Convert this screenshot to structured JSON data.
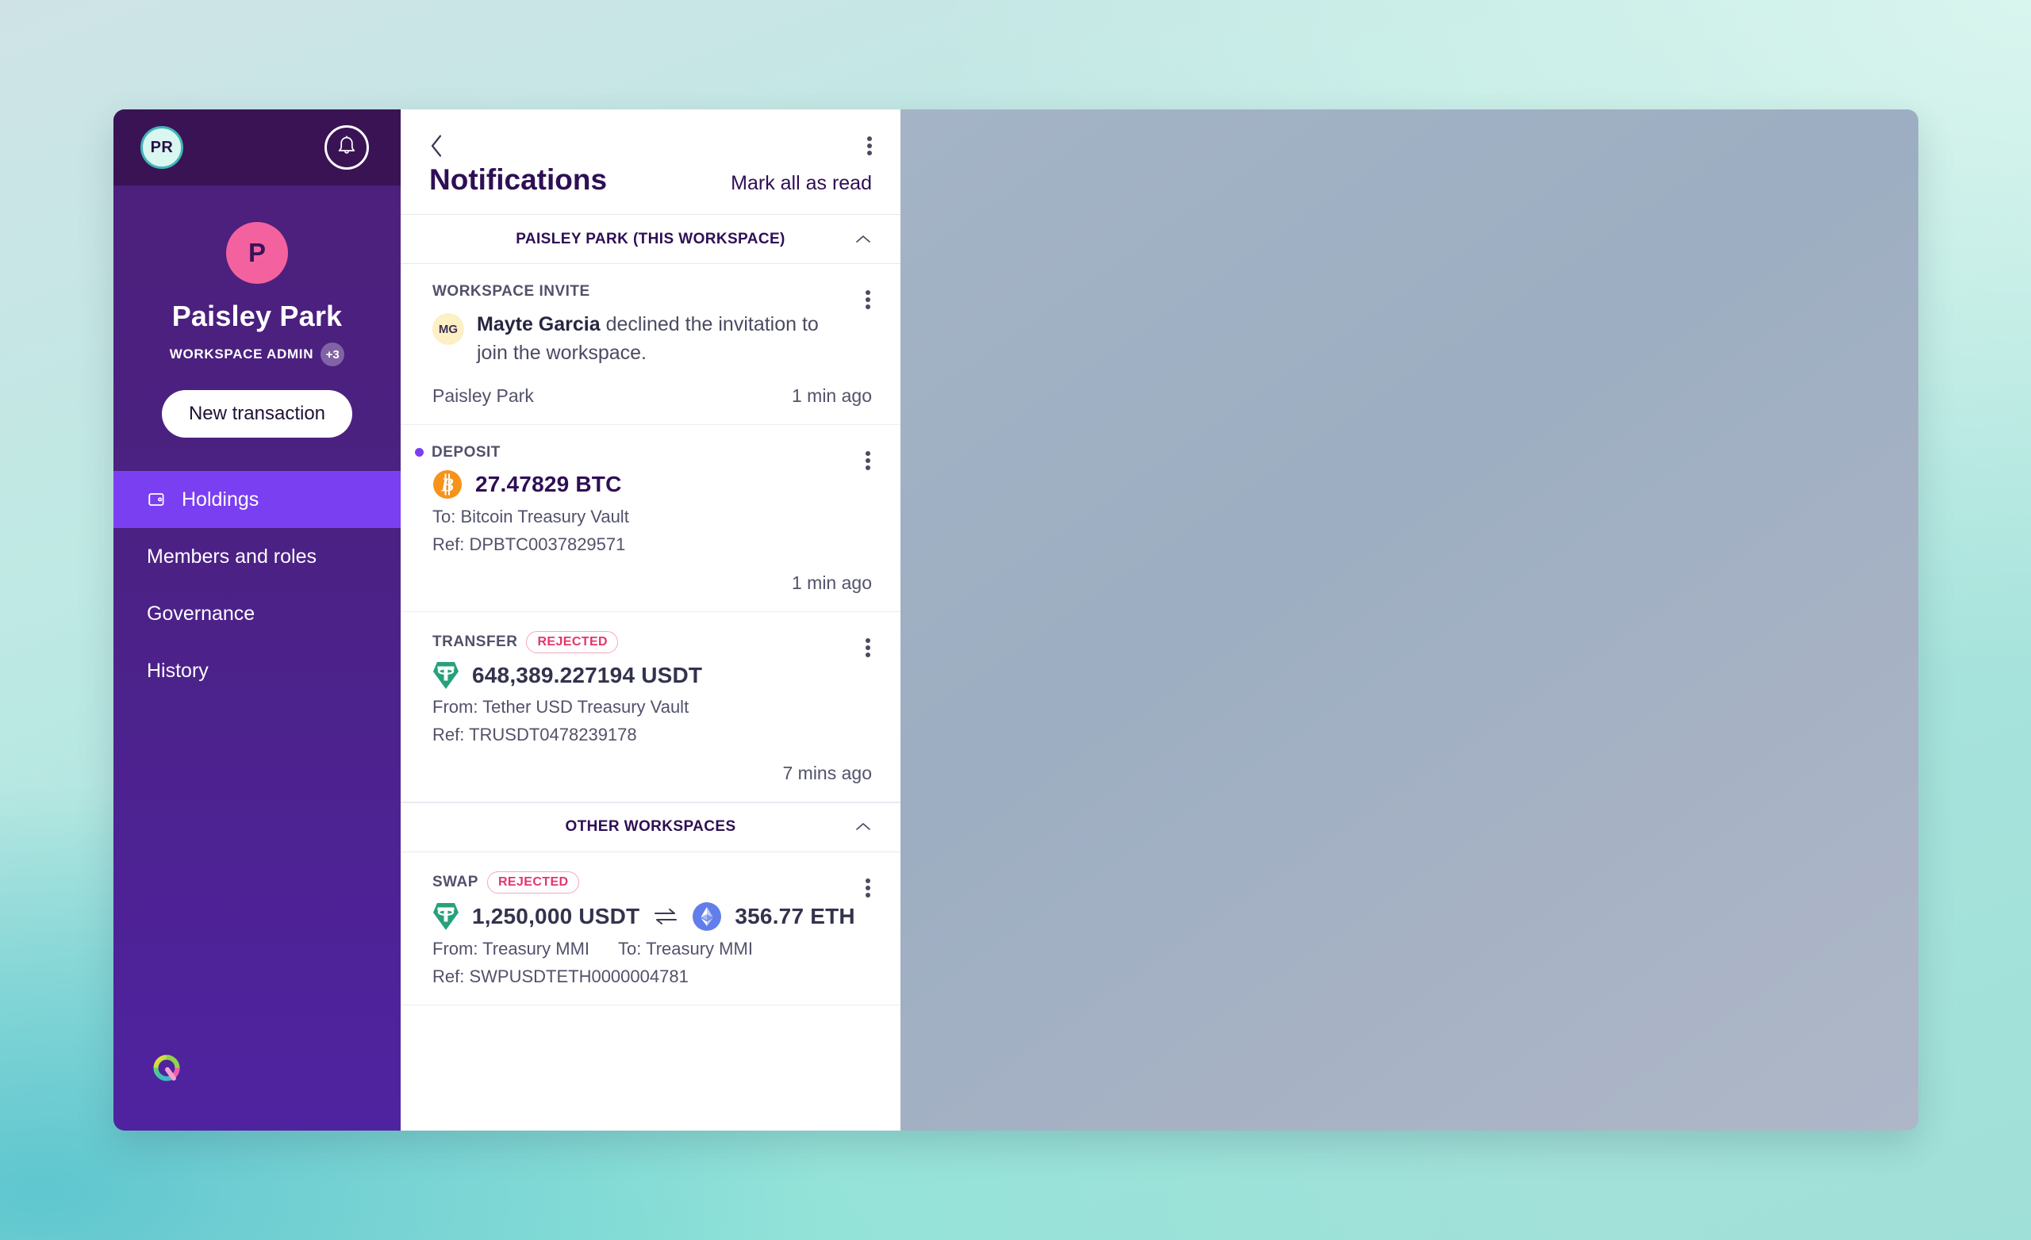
{
  "sidebar": {
    "user_initials": "PR",
    "bell_icon": "bell-icon",
    "workspace_initial": "P",
    "workspace_name": "Paisley Park",
    "role_label": "WORKSPACE ADMIN",
    "role_extra_count": "+3",
    "new_transaction_label": "New transaction",
    "nav": [
      {
        "label": "Holdings",
        "icon": "wallet-icon",
        "active": true
      },
      {
        "label": "Members and roles",
        "icon": "",
        "active": false
      },
      {
        "label": "Governance",
        "icon": "",
        "active": false
      },
      {
        "label": "History",
        "icon": "",
        "active": false
      }
    ],
    "logo_icon": "qredo-q-logo"
  },
  "notifications": {
    "back_icon": "chevron-left-icon",
    "menu_icon": "kebab-menu-icon",
    "title": "Notifications",
    "mark_all_label": "Mark all as read",
    "sections": [
      {
        "label": "PAISLEY PARK  (THIS WORKSPACE)",
        "collapse_icon": "chevron-up-icon",
        "items": [
          {
            "kind": "invite",
            "type": "WORKSPACE INVITE",
            "unread": false,
            "badge": "",
            "avatar_initials": "MG",
            "actor": "Mayte Garcia",
            "message": " declined the invitation to join the workspace.",
            "footer_left": "Paisley Park",
            "footer_right": "1 min ago"
          },
          {
            "kind": "transaction",
            "type": "DEPOSIT",
            "unread": true,
            "badge": "",
            "asset_icon": "bitcoin-icon",
            "amount": "27.47829 BTC",
            "direction_line": "To: Bitcoin Treasury Vault",
            "ref_line": "Ref: DPBTC0037829571",
            "footer_left": "",
            "footer_right": "1 min ago"
          },
          {
            "kind": "transaction",
            "type": "TRANSFER",
            "unread": false,
            "badge": "REJECTED",
            "asset_icon": "tether-icon",
            "amount": "648,389.227194 USDT",
            "direction_line": "From: Tether USD Treasury Vault",
            "ref_line": "Ref: TRUSDT0478239178",
            "footer_left": "",
            "footer_right": "7 mins ago"
          }
        ]
      },
      {
        "label": "OTHER WORKSPACES",
        "collapse_icon": "chevron-up-icon",
        "items": [
          {
            "kind": "swap",
            "type": "SWAP",
            "unread": false,
            "badge": "REJECTED",
            "asset_icon_from": "tether-icon",
            "amount_from": "1,250,000 USDT",
            "swap_icon": "swap-arrows-icon",
            "asset_icon_to": "ethereum-icon",
            "amount_to": "356.77 ETH",
            "from_line": "From: Treasury MMI",
            "to_line": "To: Treasury MMI",
            "ref_line": "Ref: SWPUSDTETH0000004781"
          }
        ]
      }
    ]
  },
  "colors": {
    "sidebar_top": "#3a1355",
    "sidebar_body": "#4b2181",
    "accent_purple": "#7b3ff2",
    "workspace_avatar": "#f4619f",
    "pr_avatar_fill": "#d9f7f0",
    "pr_avatar_ring": "#3fb6b6",
    "rejected_text": "#e5356a",
    "rejected_border": "#f5a9c0",
    "bitcoin_orange": "#f7931a",
    "tether_green": "#26a17b",
    "ethereum_blue": "#627eea",
    "heading_purple": "#2e0f55"
  }
}
